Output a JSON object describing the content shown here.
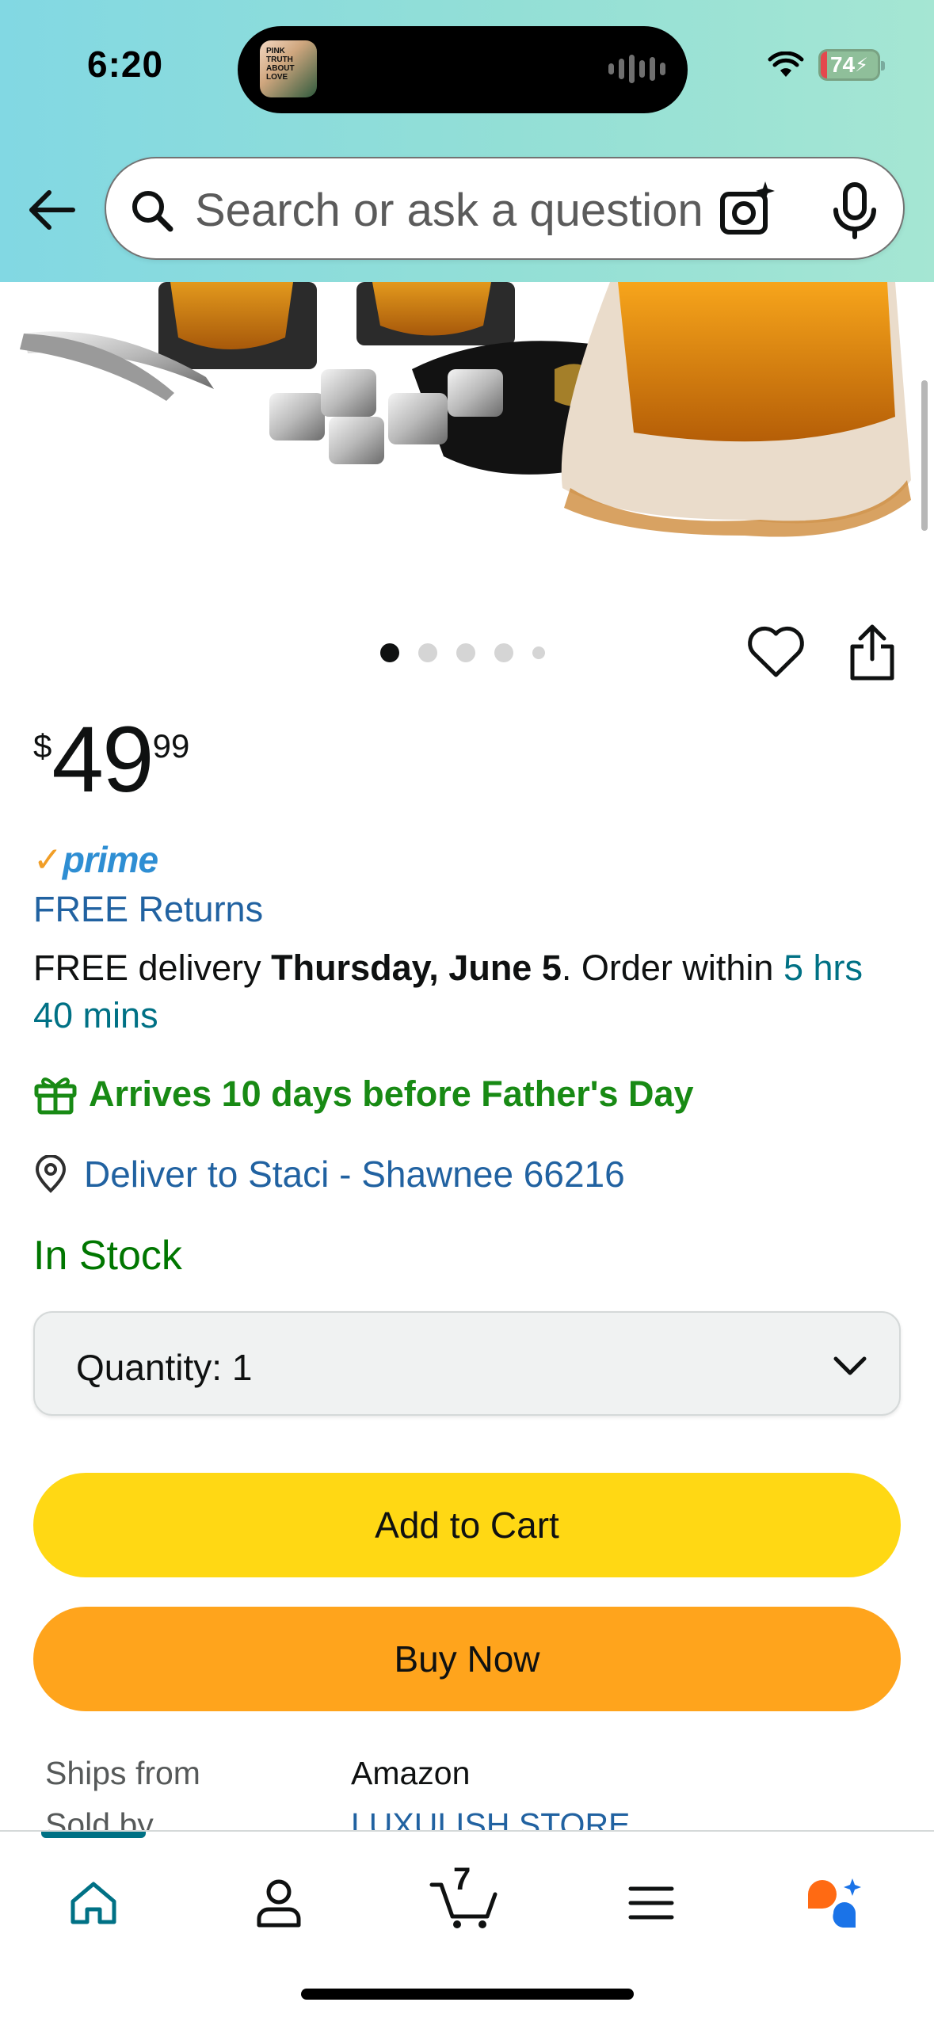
{
  "status_bar": {
    "time": "6:20",
    "battery": "74",
    "island_art_text": "PINK TRUTH ABOUT LOVE"
  },
  "search": {
    "placeholder": "Search or ask a question"
  },
  "gallery": {
    "image_count": 5,
    "active_index": 0
  },
  "price": {
    "currency": "$",
    "whole": "49",
    "fraction": "99"
  },
  "prime": {
    "label": "prime"
  },
  "free_returns": "FREE Returns",
  "delivery": {
    "prefix": "FREE delivery ",
    "date": "Thursday, June 5",
    "middle": ". Order within ",
    "countdown": "5 hrs 40 mins"
  },
  "promo": "Arrives 10 days before Father's Day",
  "deliver_to": "Deliver to Staci - Shawnee 66216",
  "availability": "In Stock",
  "quantity": {
    "label": "Quantity:",
    "value": "1"
  },
  "buttons": {
    "add_to_cart": "Add to Cart",
    "buy_now": "Buy Now"
  },
  "seller_info": {
    "ships_from_label": "Ships from",
    "ships_from_value": "Amazon",
    "sold_by_label": "Sold by",
    "sold_by_value": "LUXULISH STORE"
  },
  "bottom_nav": {
    "cart_count": "7"
  },
  "colors": {
    "header_gradient_start": "#82d8e3",
    "header_gradient_end": "#a5e6d3",
    "add_to_cart": "#ffd814",
    "buy_now": "#ffa41c",
    "link": "#2162a1",
    "in_stock": "#007600",
    "promo_green": "#188a14",
    "teal": "#007185"
  }
}
